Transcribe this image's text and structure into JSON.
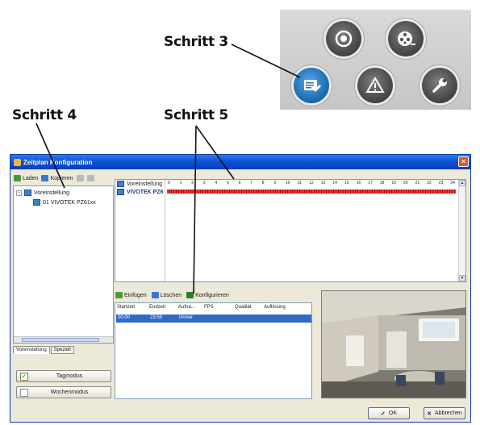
{
  "callouts": {
    "step3": "Schritt 3",
    "step4": "Schritt 4",
    "step5": "Schritt 5"
  },
  "icon_panel": {
    "icons": [
      "record-icon",
      "film-reel-icon",
      "schedule-config-icon",
      "warning-icon",
      "wrench-icon"
    ],
    "active_icon": "schedule-config-icon"
  },
  "window": {
    "title": "Zeitplan Konfiguration",
    "close_glyph": "×",
    "toolbar": {
      "load": "Laden",
      "copy": "Kopieren"
    },
    "tree": {
      "root": "Voreinstellung",
      "child": "01 VIVOTEK PZ61xx"
    },
    "tabs": [
      "Voreinstellung",
      "Speziell"
    ],
    "modes": {
      "day": "Tagmodus",
      "week": "Wochenmodus",
      "day_checked": true
    },
    "schedule": {
      "header_label": "Voreinstellung",
      "row_label": "VIVOTEK PZ6",
      "hours": [
        "0",
        "1",
        "2",
        "3",
        "4",
        "5",
        "6",
        "7",
        "8",
        "9",
        "10",
        "11",
        "12",
        "13",
        "14",
        "15",
        "16",
        "17",
        "18",
        "19",
        "20",
        "21",
        "22",
        "23",
        "24"
      ]
    },
    "actions": {
      "insert": "Einfügen",
      "delete": "Löschen",
      "configure": "Konfigurieren"
    },
    "list": {
      "columns": [
        "Startzeit",
        "Endzeit",
        "Aufna...",
        "FPS",
        "Qualität",
        "Auflösung"
      ],
      "rows": [
        {
          "start": "00:00",
          "end": "23:59",
          "record": "Immer"
        }
      ]
    },
    "buttons": {
      "ok": "OK",
      "cancel": "Abbrechen"
    }
  },
  "colors": {
    "titlebar": "#0c4fd6",
    "selection": "#3169c6",
    "schedule_bar": "#e33333",
    "active_icon": "#1f70b5"
  }
}
